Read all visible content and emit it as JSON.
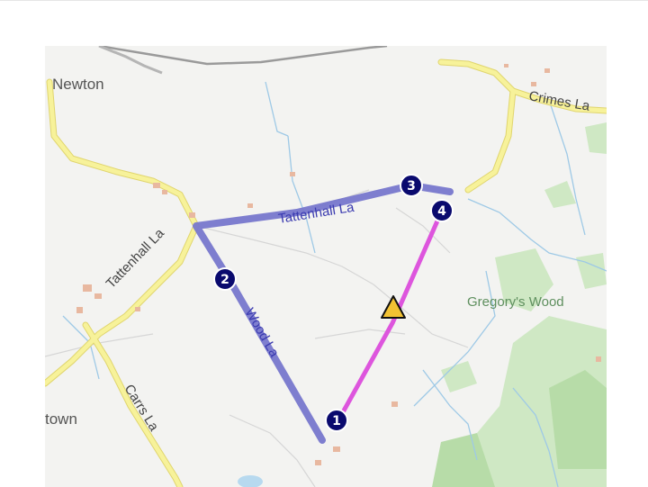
{
  "map": {
    "places": {
      "newton": "Newton",
      "town": "town"
    },
    "roads": {
      "crimes_la": "Crimes La",
      "tattenhall_la_west": "Tattenhall La",
      "carrs_la": "Carrs La"
    },
    "route_roads": {
      "tattenhall_la": "Tattenhall La",
      "wood_la": "Wood La"
    },
    "features": {
      "gregorys_wood": "Gregory's Wood"
    },
    "waypoints": [
      "1",
      "2",
      "3",
      "4"
    ],
    "colors": {
      "route_main": "#7777cc",
      "route_final_leg": "#dd55dd",
      "waypoint_fill": "#0a0a6e",
      "major_road": "#f5ee8a",
      "woodland": "#cfe8c4",
      "water": "#9ec9e6",
      "hazard_triangle": "#f2c233"
    },
    "icons": {
      "hazard": "warning-triangle-icon"
    }
  }
}
